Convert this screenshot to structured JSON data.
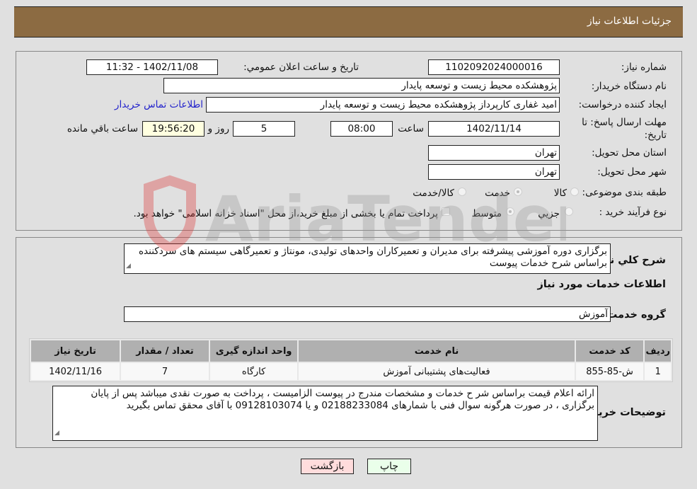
{
  "header": {
    "title": "جزئیات اطلاعات نیاز"
  },
  "details": {
    "need_number_label": "شماره نیاز:",
    "need_number": "1102092024000016",
    "announce_label": "تاریخ و ساعت اعلان عمومي:",
    "announce_value": "1402/11/08 - 11:32",
    "buyer_org_label": "نام دستگاه خريدار:",
    "buyer_org": "پژوهشکده محیط زیست و توسعه پایدار",
    "requester_label": "ايجاد کننده درخواست:",
    "requester": "امید غفاری کارپرداز پژوهشکده محیط زیست و توسعه پایدار",
    "contact_link": "اطلاعات تماس خريدار",
    "deadline_label_1": "مهلت ارسال پاسخ: تا",
    "deadline_label_2": "تاريخ:",
    "deadline_date": "1402/11/14",
    "time_label": "ساعت",
    "deadline_time": "08:00",
    "days_value": "5",
    "days_label": "روز و",
    "remaining_time": "19:56:20",
    "remaining_label": "ساعت باقي مانده",
    "province_label": "استان محل تحويل:",
    "province": "تهران",
    "city_label": "شهر محل تحويل:",
    "city": "تهران",
    "category_label": "طبقه بندی موضوعی:",
    "category_options": [
      "کالا",
      "خدمت",
      "کالا/خدمت"
    ],
    "category_selected": "خدمت",
    "process_label": "نوع فرآيند خريد :",
    "process_options": [
      "جزيي",
      "متوسط"
    ],
    "process_selected": "متوسط",
    "treasury_note": "پرداخت تمام يا بخشی از مبلغ خريد،از محل \"اسناد خزانه اسلامی\" خواهد بود."
  },
  "description": {
    "label": "شرح کلي نياز:",
    "text": "برگزاری دوره آموزشی پیشرفته برای مدیران و تعمیرکاران واحدهای تولیدی، مونتاژ و تعمیرگاهی سیستم های سردکننده براساس شرح خدمات پیوست"
  },
  "services": {
    "section_title": "اطلاعات خدمات مورد نياز",
    "group_label": "گروه خدمت:",
    "group_value": "آموزش",
    "columns": [
      "رديف",
      "کد خدمت",
      "نام خدمت",
      "واحد اندازه گيری",
      "تعداد / مقدار",
      "تاريخ نياز"
    ],
    "rows": [
      {
        "row": "1",
        "code": "ش-85-855",
        "name": "فعالیت‌های پشتیبانی آموزش",
        "unit": "کارگاه",
        "qty": "7",
        "date": "1402/11/16"
      }
    ]
  },
  "buyer_notes": {
    "label": "توضيحات خريدار:",
    "text": "ارائه اعلام قیمت  براساس  شر ح خدمات  و مشخصات مندرج در پیوست الزامیست ، پرداخت به صورت نقدی میباشد پس از پایان برگزاری ، در صورت هرگونه سوال فنی با شمارهای 02188233084 و یا 09128103074 با  آقای محقق تماس بگیرید"
  },
  "buttons": {
    "print": "چاپ",
    "back": "بازگشت"
  },
  "watermark": {
    "text": "AriaTender.neT"
  }
}
